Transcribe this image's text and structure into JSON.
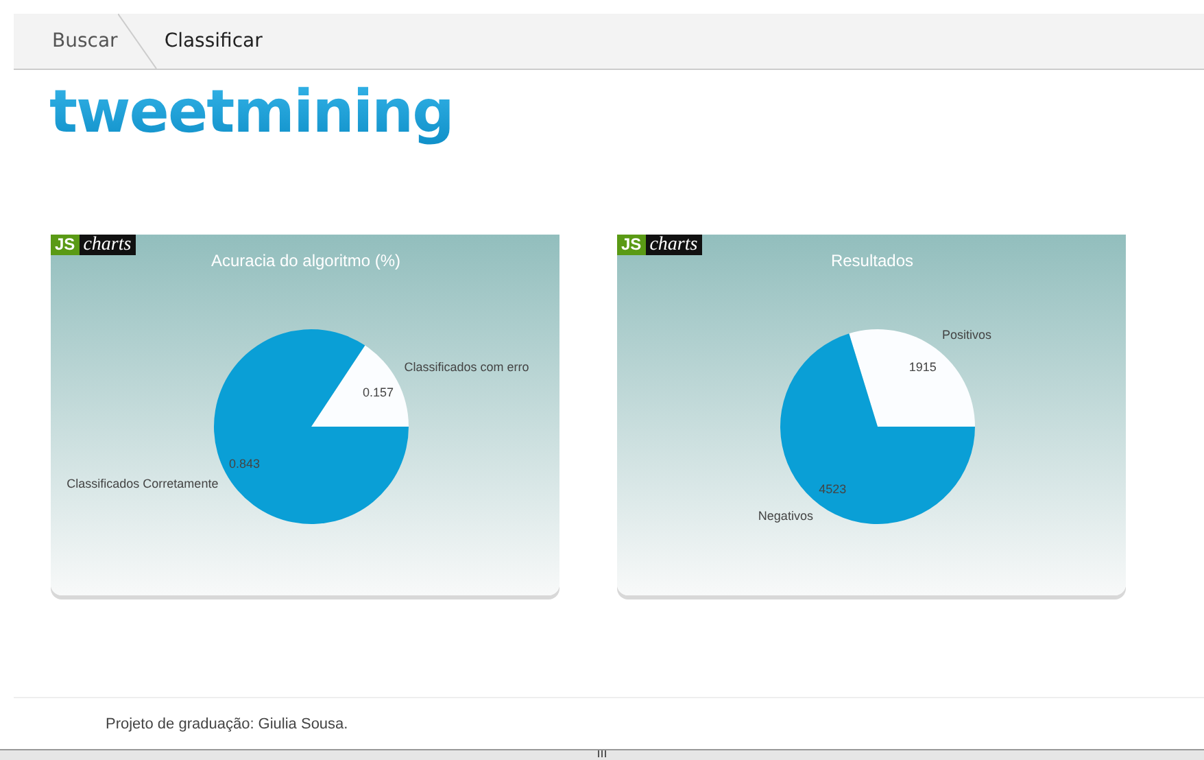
{
  "nav": {
    "items": [
      {
        "label": "Buscar",
        "selected": false
      },
      {
        "label": "Classificar",
        "selected": true
      }
    ]
  },
  "logo": "tweetmining",
  "charts": [
    {
      "badge": {
        "left": "JS",
        "right": "charts"
      },
      "chart_data": {
        "type": "pie",
        "title": "Acuracia do algoritmo (%)",
        "categories": [
          "Classificados com erro",
          "Classificados Corretamente"
        ],
        "values": [
          0.157,
          0.843
        ],
        "colors": [
          "#fbfdff",
          "#0a9fd6"
        ],
        "data_labels": true
      }
    },
    {
      "badge": {
        "left": "JS",
        "right": "charts"
      },
      "chart_data": {
        "type": "pie",
        "title": "Resultados",
        "categories": [
          "Positivos",
          "Negativos"
        ],
        "values": [
          1915,
          4523
        ],
        "colors": [
          "#fbfdff",
          "#0a9fd6"
        ],
        "data_labels": true
      }
    }
  ],
  "footer": "Projeto de graduação: Giulia Sousa."
}
